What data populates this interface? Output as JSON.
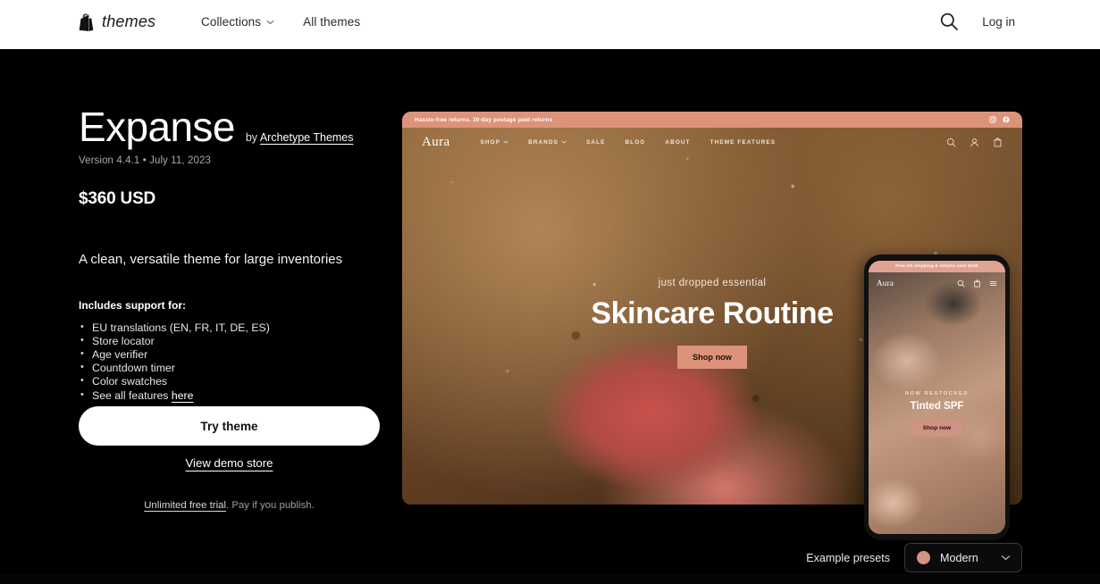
{
  "header": {
    "logo_icon": "shopify-bag-icon",
    "logo_word": "themes",
    "nav": [
      {
        "label": "Collections",
        "has_chevron": true,
        "icon": "chevron-down-icon"
      },
      {
        "label": "All themes",
        "has_chevron": false
      }
    ],
    "search_icon": "search-icon",
    "login_label": "Log in"
  },
  "theme": {
    "name": "Expanse",
    "by_prefix": "by",
    "author": "Archetype Themes",
    "version_line": "Version 4.4.1 • July 11, 2023",
    "price": "$360 USD",
    "tagline": "A clean, versatile theme for large inventories",
    "includes_heading": "Includes support for:",
    "features": [
      {
        "text": "EU translations (EN, FR, IT, DE, ES)",
        "link": ""
      },
      {
        "text": "Store locator",
        "link": ""
      },
      {
        "text": "Age verifier",
        "link": ""
      },
      {
        "text": "Countdown timer",
        "link": ""
      },
      {
        "text": "Color swatches",
        "link": ""
      },
      {
        "text": "See all features ",
        "link": "here"
      }
    ],
    "try_button": "Try theme",
    "demo_link": "View demo store",
    "trial_link": "Unlimited free trial",
    "trial_rest": ". Pay if you publish."
  },
  "preview": {
    "announcement": "Hassle-free returns. 30-day postage paid returns",
    "social_icons": [
      "instagram-icon",
      "facebook-icon"
    ],
    "store_name": "Aura",
    "store_nav": [
      {
        "label": "SHOP",
        "has_chevron": true
      },
      {
        "label": "BRANDS",
        "has_chevron": true
      },
      {
        "label": "SALE",
        "has_chevron": false
      },
      {
        "label": "BLOG",
        "has_chevron": false
      },
      {
        "label": "ABOUT",
        "has_chevron": false
      },
      {
        "label": "THEME FEATURES",
        "has_chevron": false
      }
    ],
    "store_icons": [
      "search-icon",
      "account-icon",
      "cart-icon"
    ],
    "hero_kicker": "just dropped essential",
    "hero_heading": "Skincare Routine",
    "hero_button": "Shop now",
    "accent_color": "#dd937a"
  },
  "phone": {
    "announcement": "Free US shipping & returns over $100",
    "store_name": "Aura",
    "icons": [
      "search-icon",
      "cart-icon",
      "menu-icon"
    ],
    "kicker": "NOW RESTOCKED",
    "heading": "Tinted SPF",
    "button": "Shop now"
  },
  "presets": {
    "label": "Example presets",
    "selected": "Modern",
    "swatch_color": "#d69383",
    "chevron_icon": "chevron-down-icon"
  }
}
